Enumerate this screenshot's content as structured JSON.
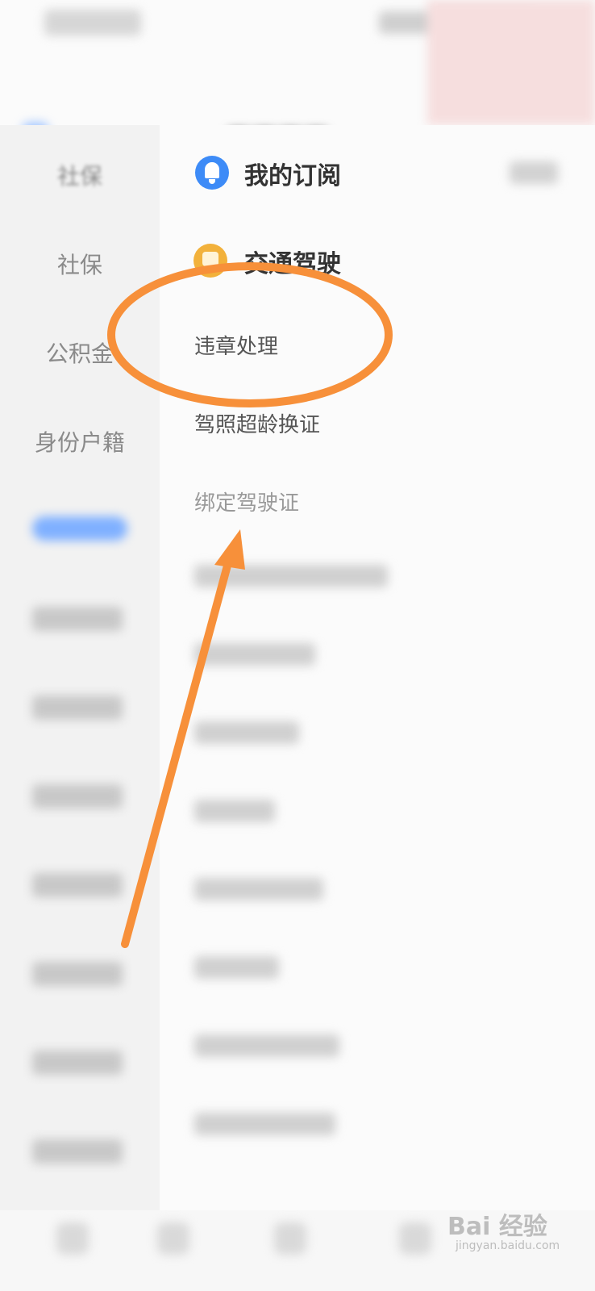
{
  "sidebar": {
    "items": [
      "社保",
      "社保",
      "公积金",
      "身份户籍"
    ]
  },
  "subscription": {
    "title": "我的订阅",
    "icon": "bell-icon"
  },
  "traffic": {
    "title": "交通驾驶",
    "icon": "car-icon",
    "services": [
      "违章处理",
      "驾照超龄换证",
      "绑定驾驶证"
    ]
  },
  "watermark": {
    "brand": "Bai 经验",
    "url": "jingyan.baidu.com"
  },
  "colors": {
    "annotation": "#f7903a",
    "accent": "#3d8bf7",
    "traffic_icon": "#f2b13b"
  }
}
